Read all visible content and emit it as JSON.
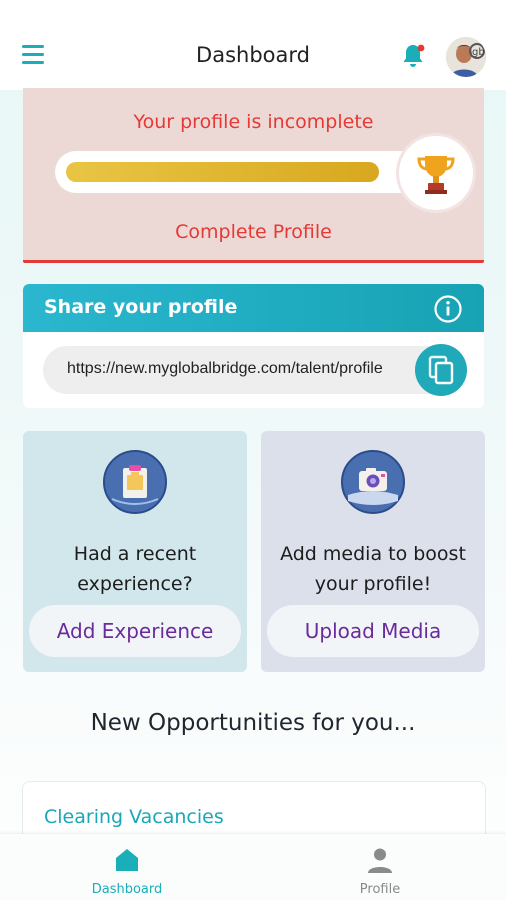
{
  "header": {
    "title": "Dashboard",
    "menu_icon": "hamburger-menu-icon",
    "notification_icon": "bell-icon",
    "has_notification": true,
    "avatar_label": "user-avatar"
  },
  "profile_status": {
    "message": "Your profile is incomplete",
    "progress_fraction": 0.9,
    "badge_icon": "trophy-icon",
    "action_label": "Complete Profile"
  },
  "share_profile": {
    "title": "Share your profile",
    "info_icon": "info-icon",
    "url": "https://new.myglobalbridge.com/talent/profile",
    "copy_icon": "copy-icon"
  },
  "tiles": [
    {
      "icon": "clipboard-icon",
      "text_line1": "Had a recent",
      "text_line2": "experience?",
      "button_label": "Add Experience"
    },
    {
      "icon": "camera-icon",
      "text_line1": "Add media to boost",
      "text_line2": "your profile!",
      "button_label": "Upload Media"
    }
  ],
  "opportunities": {
    "heading": "New Opportunities for you...",
    "first_card_title": "Clearing Vacancies"
  },
  "bottom_nav": {
    "items": [
      {
        "label": "Dashboard",
        "icon": "home-icon",
        "active": true
      },
      {
        "label": "Profile",
        "icon": "person-icon",
        "active": false
      }
    ]
  },
  "colors": {
    "accent": "#1aaeb8",
    "alert": "#e53935",
    "button_text": "#6a2c9c",
    "progress": "#d8a81f"
  }
}
